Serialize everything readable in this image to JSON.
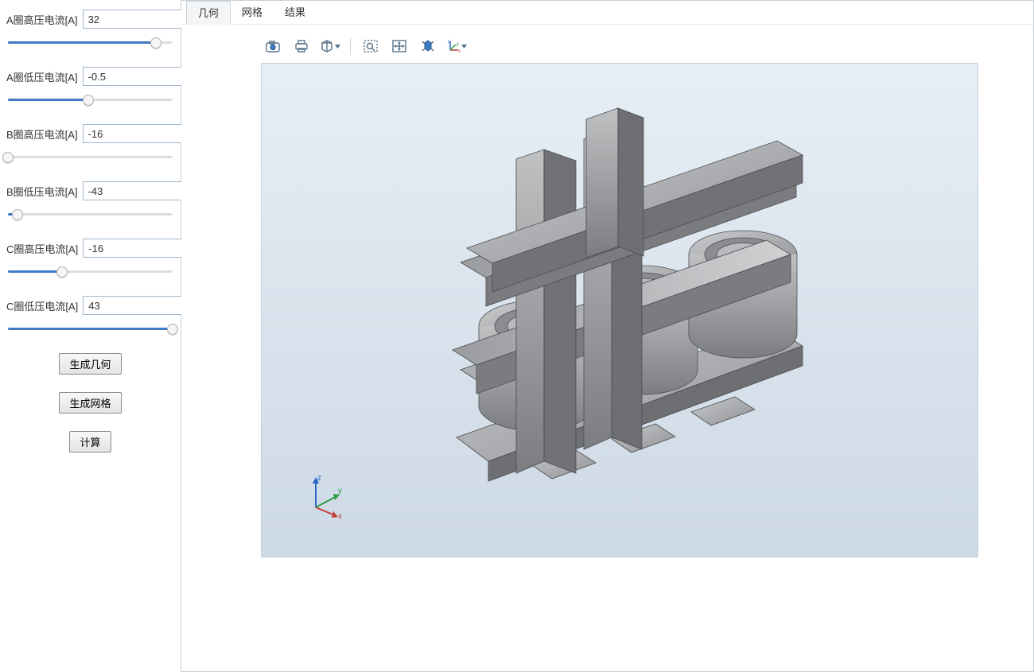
{
  "sidebar": {
    "params": [
      {
        "label": "A圈高压电流[A]",
        "value": "32",
        "slider_pct": 90
      },
      {
        "label": "A圈低压电流[A]",
        "value": "-0.5",
        "slider_pct": 49
      },
      {
        "label": "B圈高压电流[A]",
        "value": "-16",
        "slider_pct": 0
      },
      {
        "label": "B圈低压电流[A]",
        "value": "-43",
        "slider_pct": 6
      },
      {
        "label": "C圈高压电流[A]",
        "value": "-16",
        "slider_pct": 33
      },
      {
        "label": "C圈低压电流[A]",
        "value": "43",
        "slider_pct": 100
      }
    ],
    "buttons": {
      "generate_geometry": "生成几何",
      "generate_mesh": "生成网格",
      "compute": "计算"
    }
  },
  "tabs": {
    "items": [
      {
        "label": "几何",
        "active": true
      },
      {
        "label": "网格",
        "active": false
      },
      {
        "label": "结果",
        "active": false
      }
    ]
  },
  "toolbar": {
    "icons": [
      "snapshot-icon",
      "print-icon",
      "display-mode-icon",
      "sep",
      "zoom-box-icon",
      "pan-icon",
      "zoom-extents-icon",
      "axis-triad-icon"
    ]
  },
  "viewport": {
    "axis_labels": {
      "x": "x",
      "y": "y",
      "z": "z"
    }
  }
}
